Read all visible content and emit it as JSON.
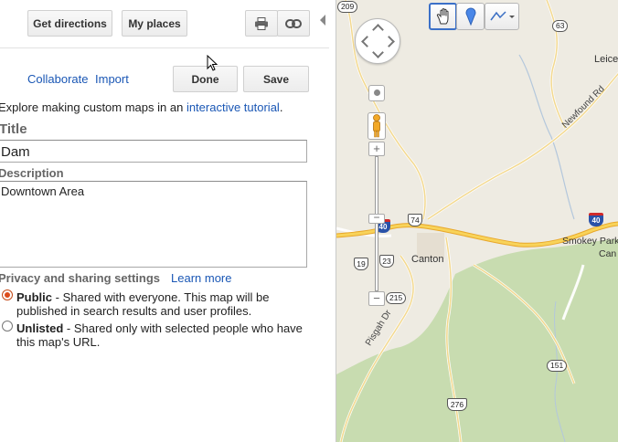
{
  "toolbar": {
    "get_directions": "Get directions",
    "my_places": "My places",
    "print_icon": "print-icon",
    "link_icon": "link-icon",
    "collapse_icon": "collapse-arrow-icon"
  },
  "edit_bar": {
    "collaborate": "Collaborate",
    "import": "Import",
    "done": "Done",
    "save": "Save"
  },
  "intro": {
    "text": "Explore making custom maps in an ",
    "link": "interactive tutorial",
    "end": "."
  },
  "form": {
    "title_label": "Title",
    "title_value": "Dam",
    "description_label": "Description",
    "description_value": "Downtown Area"
  },
  "privacy": {
    "label": "Privacy and sharing settings",
    "learn_more": "Learn more",
    "options": [
      {
        "title": "Public",
        "desc": " - Shared with everyone. This map will be published in search results and user profiles.",
        "selected": true
      },
      {
        "title": "Unlisted",
        "desc": " - Shared only with selected people who have this map's URL.",
        "selected": false
      }
    ]
  },
  "map": {
    "tools": [
      "hand-tool-icon",
      "placemark-tool-icon",
      "line-tool-icon"
    ],
    "town": "Canton",
    "labels": {
      "newfound_rd": "Newfound Rd",
      "pisgah_dr": "Pisgah Dr",
      "leice": "Leice",
      "smokey_park": "Smokey Park H",
      "can": "Can"
    },
    "shields": {
      "r209": "209",
      "r63": "63",
      "i40a": "40",
      "i40b": "40",
      "r74": "74",
      "r19": "19",
      "r23": "23",
      "r215": "215",
      "r151": "151",
      "r276": "276"
    },
    "colors": {
      "forest": "#c8dcb0",
      "land": "#eeebe2",
      "highway": "#f5c242",
      "road": "#fff2b0"
    }
  }
}
